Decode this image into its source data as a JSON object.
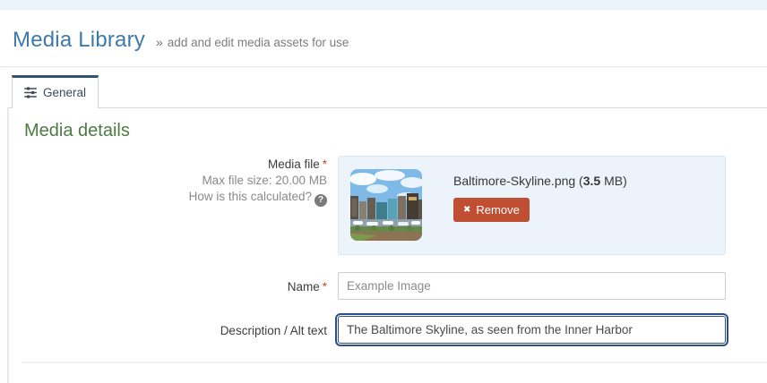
{
  "header": {
    "title": "Media Library",
    "separator": "»",
    "subtitle": "add and edit media assets for use"
  },
  "tabs": {
    "general": {
      "label": "General",
      "icon": "sliders-icon",
      "active": true
    }
  },
  "panel": {
    "heading": "Media details"
  },
  "form": {
    "media_file": {
      "label": "Media file",
      "required_marker": "*",
      "max_size_text": "Max file size: 20.00 MB",
      "help_link_text": "How is this calculated?",
      "help_icon_glyph": "?",
      "file_name_prefix": "Baltimore-Skyline.png (",
      "file_size_bold": "3.5",
      "file_name_suffix": " MB)",
      "thumbnail": "baltimore-skyline-thumbnail",
      "remove_icon": "✖",
      "remove_label": "Remove"
    },
    "name": {
      "label": "Name",
      "required_marker": "*",
      "value": "Example Image"
    },
    "description": {
      "label": "Description / Alt text",
      "value": "The Baltimore Skyline, as seen from the Inner Harbor",
      "focused": true
    }
  },
  "colors": {
    "topbar_bg": "#edf3fa",
    "title_blue": "#3e79ab",
    "heading_green": "#4d7c43",
    "tab_accent": "#2e5470",
    "required_red": "#cc4b37",
    "remove_button_red": "#bf4e33",
    "filebox_bg": "#ecf3fa",
    "focus_border_blue": "#2d4e86"
  }
}
